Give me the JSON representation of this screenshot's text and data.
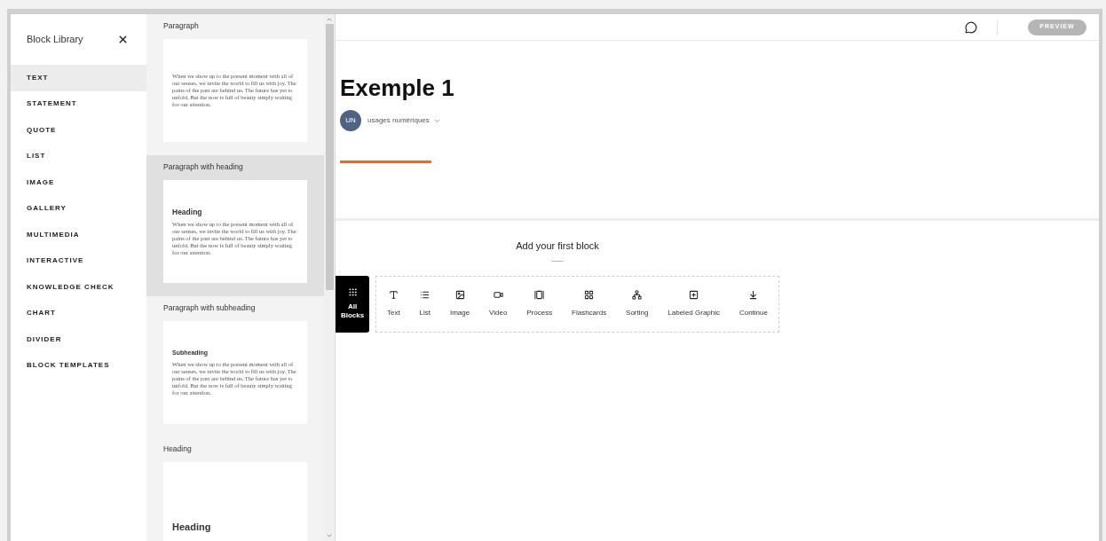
{
  "block_library": {
    "title": "Block Library",
    "categories": [
      {
        "label": "TEXT",
        "selected": true
      },
      {
        "label": "STATEMENT",
        "selected": false
      },
      {
        "label": "QUOTE",
        "selected": false
      },
      {
        "label": "LIST",
        "selected": false
      },
      {
        "label": "IMAGE",
        "selected": false
      },
      {
        "label": "GALLERY",
        "selected": false
      },
      {
        "label": "MULTIMEDIA",
        "selected": false
      },
      {
        "label": "INTERACTIVE",
        "selected": false
      },
      {
        "label": "KNOWLEDGE CHECK",
        "selected": false
      },
      {
        "label": "CHART",
        "selected": false
      },
      {
        "label": "DIVIDER",
        "selected": false
      },
      {
        "label": "BLOCK TEMPLATES",
        "selected": false
      }
    ]
  },
  "templates": [
    {
      "name": "Paragraph",
      "hovered": false,
      "kind": "paragraph",
      "body": "When we show up to the present moment with all of our senses, we invite the world to fill us with joy. The pains of the past are behind us. The future has yet to unfold. But the now is full of beauty simply waiting for our attention."
    },
    {
      "name": "Paragraph with heading",
      "hovered": true,
      "kind": "heading_paragraph",
      "heading": "Heading",
      "body": "When we show up to the present moment with all of our senses, we invite the world to fill us with joy. The pains of the past are behind us. The future has yet to unfold. But the now is full of beauty simply waiting for our attention."
    },
    {
      "name": "Paragraph with subheading",
      "hovered": false,
      "kind": "subheading_paragraph",
      "heading": "Subheading",
      "body": "When we show up to the present moment with all of our senses, we invite the world to fill us with joy. The pains of the past are behind us. The future has yet to unfold. But the now is full of beauty simply waiting for our attention."
    },
    {
      "name": "Heading",
      "hovered": false,
      "kind": "heading",
      "heading": "Heading"
    }
  ],
  "header": {
    "preview_button": "PREVIEW"
  },
  "lesson": {
    "title": "Exemple 1",
    "author_initials": "UN",
    "author": "usages numériques"
  },
  "add_block": {
    "prompt": "Add your first block",
    "all_blocks": "All Blocks",
    "blocks": [
      {
        "label": "Text",
        "kind": "text"
      },
      {
        "label": "List",
        "kind": "list"
      },
      {
        "label": "Image",
        "kind": "image"
      },
      {
        "label": "Video",
        "kind": "video"
      },
      {
        "label": "Process",
        "kind": "process"
      },
      {
        "label": "Flashcards",
        "kind": "flashcards"
      },
      {
        "label": "Sorting",
        "kind": "sorting"
      },
      {
        "label": "Labeled Graphic",
        "kind": "labeled_graphic"
      },
      {
        "label": "Continue",
        "kind": "continue"
      }
    ]
  }
}
